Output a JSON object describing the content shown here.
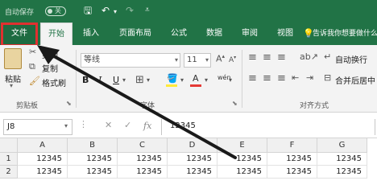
{
  "titlebar": {
    "autosave_label": "自动保存",
    "toggle_label": "关"
  },
  "tabs": [
    "文件",
    "开始",
    "插入",
    "页面布局",
    "公式",
    "数据",
    "审阅",
    "视图"
  ],
  "tell_me": "告诉我你想要做什么",
  "ribbon": {
    "paste": "粘贴",
    "cut": "剪切",
    "copy": "复制",
    "format_painter": "格式刷",
    "clipboard_group": "剪贴板",
    "font_name": "等线",
    "font_size": "11",
    "font_group": "字体",
    "bold": "B",
    "italic": "I",
    "underline": "U",
    "wrap_text": "自动换行",
    "merge_center": "合并后居中",
    "alignment_group": "对齐方式",
    "phonetic": "wén"
  },
  "formula_bar": {
    "name_box": "J8",
    "fx": "fx",
    "value": "12345"
  },
  "grid": {
    "columns": [
      "A",
      "B",
      "C",
      "D",
      "E",
      "F",
      "G"
    ],
    "rows": [
      {
        "num": "1",
        "cells": [
          "12345",
          "12345",
          "12345",
          "12345",
          "12345",
          "12345",
          "12345"
        ]
      },
      {
        "num": "2",
        "cells": [
          "12345",
          "12345",
          "12345",
          "12345",
          "12345",
          "12345",
          "12345"
        ]
      }
    ]
  },
  "colors": {
    "excel_green": "#217346",
    "highlight_red": "#e03030",
    "arrow": "#1a1a1a"
  }
}
